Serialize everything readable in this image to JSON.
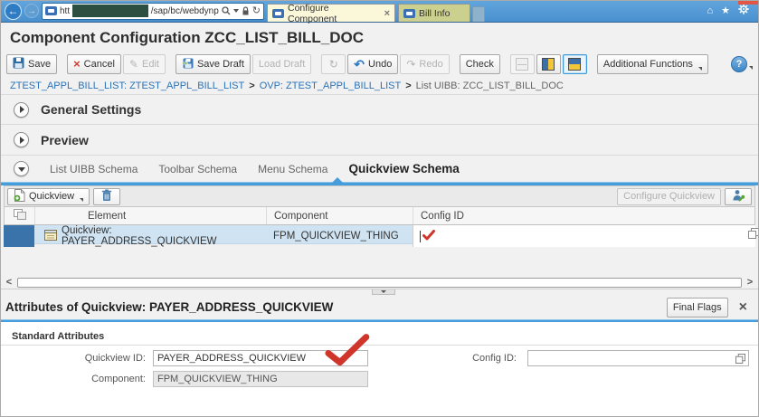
{
  "browser": {
    "address": {
      "prefix": "htt",
      "path": "/sap/bc/webdynp"
    },
    "tabs": [
      {
        "label": "Configure Component"
      },
      {
        "label": "Bill Info"
      }
    ]
  },
  "page_title": "Component Configuration ZCC_LIST_BILL_DOC",
  "toolbar": {
    "save": "Save",
    "cancel": "Cancel",
    "edit": "Edit",
    "save_draft": "Save Draft",
    "load_draft": "Load Draft",
    "undo": "Undo",
    "redo": "Redo",
    "check": "Check",
    "additional_functions": "Additional Functions"
  },
  "breadcrumb": {
    "separator": ">",
    "items": [
      {
        "label": "ZTEST_APPL_BILL_LIST: ZTEST_APPL_BILL_LIST"
      },
      {
        "label": "OVP: ZTEST_APPL_BILL_LIST"
      },
      {
        "label": "List UIBB: ZCC_LIST_BILL_DOC"
      }
    ]
  },
  "sections": {
    "general_settings": "General Settings",
    "preview": "Preview"
  },
  "schema_tabs": [
    {
      "label": "List UIBB Schema"
    },
    {
      "label": "Toolbar Schema"
    },
    {
      "label": "Menu Schema"
    },
    {
      "label": "Quickview Schema"
    }
  ],
  "quickview_panel": {
    "add_button": "Quickview",
    "configure_button": "Configure Quickview",
    "columns": {
      "element": "Element",
      "component": "Component",
      "config_id": "Config ID"
    },
    "row": {
      "element": "Quickview: PAYER_ADDRESS_QUICKVIEW",
      "component": "FPM_QUICKVIEW_THING",
      "config_id": ""
    }
  },
  "attributes_panel": {
    "title": "Attributes of Quickview: PAYER_ADDRESS_QUICKVIEW",
    "final_flags": "Final Flags",
    "group": "Standard Attributes",
    "quickview_id": {
      "label": "Quickview ID:",
      "value": "PAYER_ADDRESS_QUICKVIEW"
    },
    "component": {
      "label": "Component:",
      "value": "FPM_QUICKVIEW_THING"
    },
    "config_id": {
      "label": "Config ID:",
      "value": ""
    }
  },
  "glyphs": {
    "back": "←",
    "forward": "→",
    "refresh": "↻",
    "undo": "↶",
    "redo": "↷",
    "pencil": "✎",
    "cancel_x": "×",
    "help": "?",
    "home": "⌂",
    "star": "★",
    "close": "×",
    "scroll_left": "<",
    "scroll_right": ">"
  },
  "colors": {
    "accent_blue": "#459ddb",
    "selection_blue": "#cfe3f2",
    "selector_dark_blue": "#3a72aa",
    "check_red": "#cf352b",
    "chrome_blue": "#4e96d6"
  }
}
